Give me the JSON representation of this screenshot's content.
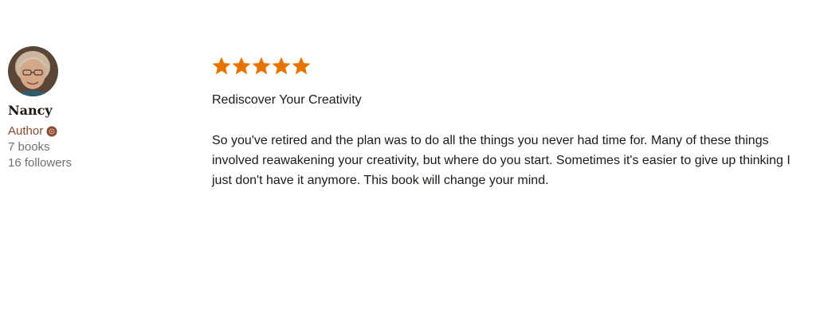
{
  "reviewer": {
    "name": "Nancy",
    "role": "Author",
    "books": "7 books",
    "followers": "16 followers",
    "avatar_icon": "user-avatar-photo",
    "badge_icon": "author-badge-icon",
    "badge_color": "#8a4a2f"
  },
  "review": {
    "rating": 5,
    "rating_max": 5,
    "star_color": "#e87400",
    "title": "Rediscover Your Creativity",
    "body": "So you've retired and the plan was to do all the things you never had time for. Many of these things involved reawakening your creativity, but where do you start. Sometimes it's easier to give up thinking I just don't have it anymore. This book will change your mind."
  }
}
